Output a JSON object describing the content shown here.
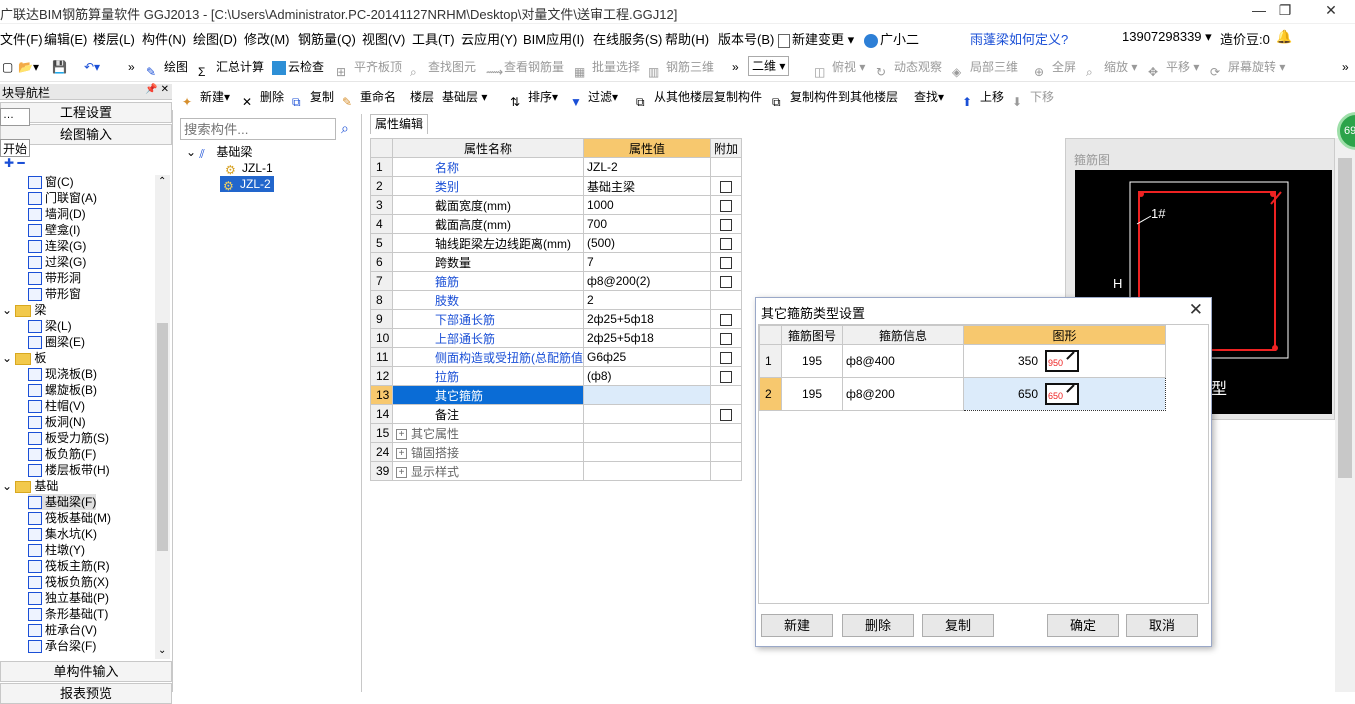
{
  "window": {
    "title": "广联达BIM钢筋算量软件 GGJ2013 - [C:\\Users\\Administrator.PC-20141127NRHM\\Desktop\\对量文件\\送审工程.GGJ12]",
    "min": "—",
    "restore": "❐",
    "close": "✕"
  },
  "menu": [
    "文件(F)",
    "编辑(E)",
    "楼层(L)",
    "构件(N)",
    "绘图(D)",
    "修改(M)",
    "钢筋量(Q)",
    "视图(V)",
    "工具(T)",
    "云应用(Y)",
    "BIM应用(I)",
    "在线服务(S)",
    "帮助(H)",
    "版本号(B)",
    "新建变更",
    "广小二",
    "雨蓬梁如何定义?",
    "13907298339",
    "造价豆:0"
  ],
  "toolbar1": [
    "绘图",
    "汇总计算",
    "云检查",
    "平齐板顶",
    "查找图元",
    "查看钢筋量",
    "批量选择",
    "钢筋三维",
    "二维",
    "俯视",
    "动态观察",
    "局部三维",
    "全屏",
    "缩放",
    "平移",
    "屏幕旋转"
  ],
  "toolbar2": [
    "新建",
    "删除",
    "复制",
    "重命名",
    "楼层",
    "基础层",
    "排序",
    "过滤",
    "从其他楼层复制构件",
    "复制构件到其他楼层",
    "查找",
    "上移",
    "下移"
  ],
  "left_panel": {
    "title": "块导航栏",
    "pin": "📌 ✕",
    "btn_project": "工程设置",
    "btn_draw": "绘图输入",
    "start_label": "开始",
    "small_box": "…",
    "items": [
      {
        "label": "窗(C)",
        "indent": 2
      },
      {
        "label": "门联窗(A)",
        "indent": 2
      },
      {
        "label": "墙洞(D)",
        "indent": 2
      },
      {
        "label": "壁龛(I)",
        "indent": 2
      },
      {
        "label": "连梁(G)",
        "indent": 2
      },
      {
        "label": "过梁(G)",
        "indent": 2
      },
      {
        "label": "带形洞",
        "indent": 2
      },
      {
        "label": "带形窗",
        "indent": 2
      },
      {
        "label": "梁",
        "indent": 1,
        "folder": true
      },
      {
        "label": "梁(L)",
        "indent": 2
      },
      {
        "label": "圈梁(E)",
        "indent": 2
      },
      {
        "label": "板",
        "indent": 1,
        "folder": true
      },
      {
        "label": "现浇板(B)",
        "indent": 2
      },
      {
        "label": "螺旋板(B)",
        "indent": 2
      },
      {
        "label": "柱帽(V)",
        "indent": 2
      },
      {
        "label": "板洞(N)",
        "indent": 2
      },
      {
        "label": "板受力筋(S)",
        "indent": 2
      },
      {
        "label": "板负筋(F)",
        "indent": 2
      },
      {
        "label": "楼层板带(H)",
        "indent": 2
      },
      {
        "label": "基础",
        "indent": 1,
        "folder": true
      },
      {
        "label": "基础梁(F)",
        "indent": 2,
        "selected": true
      },
      {
        "label": "筏板基础(M)",
        "indent": 2
      },
      {
        "label": "集水坑(K)",
        "indent": 2
      },
      {
        "label": "柱墩(Y)",
        "indent": 2
      },
      {
        "label": "筏板主筋(R)",
        "indent": 2
      },
      {
        "label": "筏板负筋(X)",
        "indent": 2
      },
      {
        "label": "独立基础(P)",
        "indent": 2
      },
      {
        "label": "条形基础(T)",
        "indent": 2
      },
      {
        "label": "桩承台(V)",
        "indent": 2
      },
      {
        "label": "承台梁(F)",
        "indent": 2
      }
    ],
    "btn_single": "单构件输入",
    "btn_report": "报表预览"
  },
  "component_tree": {
    "search_placeholder": "搜索构件...",
    "root": "基础梁",
    "children": [
      "JZL-1",
      "JZL-2"
    ]
  },
  "properties": {
    "tab": "属性编辑",
    "headers": [
      "属性名称",
      "属性值",
      "附加"
    ],
    "rows": [
      {
        "n": "1",
        "name": "名称",
        "value": "JZL-2",
        "blue": true,
        "cb": false
      },
      {
        "n": "2",
        "name": "类别",
        "value": "基础主梁",
        "blue": true,
        "cb": true
      },
      {
        "n": "3",
        "name": "截面宽度(mm)",
        "value": "1000",
        "cb": true
      },
      {
        "n": "4",
        "name": "截面高度(mm)",
        "value": "700",
        "cb": true
      },
      {
        "n": "5",
        "name": "轴线距梁左边线距离(mm)",
        "value": "(500)",
        "cb": true
      },
      {
        "n": "6",
        "name": "跨数量",
        "value": "7",
        "cb": true
      },
      {
        "n": "7",
        "name": "箍筋",
        "value": "ф8@200(2)",
        "blue": true,
        "cb": true
      },
      {
        "n": "8",
        "name": "肢数",
        "value": "2",
        "blue": true,
        "cb": false
      },
      {
        "n": "9",
        "name": "下部通长筋",
        "value": "2ф25+5ф18",
        "blue": true,
        "cb": true
      },
      {
        "n": "10",
        "name": "上部通长筋",
        "value": "2ф25+5ф18",
        "blue": true,
        "cb": true
      },
      {
        "n": "11",
        "name": "侧面构造或受扭筋(总配筋值)",
        "value": "G6ф25",
        "blue": true,
        "cb": true
      },
      {
        "n": "12",
        "name": "拉筋",
        "value": "(ф8)",
        "blue": true,
        "cb": true
      },
      {
        "n": "13",
        "name": "其它箍筋",
        "value": "",
        "selected": true,
        "cb": false
      },
      {
        "n": "14",
        "name": "备注",
        "value": "",
        "cb": true
      },
      {
        "n": "15",
        "name": "其它属性",
        "value": "",
        "group": true
      },
      {
        "n": "24",
        "name": "锚固搭接",
        "value": "",
        "group": true
      },
      {
        "n": "39",
        "name": "显示样式",
        "value": "",
        "group": true
      }
    ]
  },
  "preview": {
    "label": "箍筋图",
    "mark": "1#",
    "h_label": "H",
    "partial": "型"
  },
  "dialog": {
    "title": "其它箍筋类型设置",
    "close": "✕",
    "headers": [
      "箍筋图号",
      "箍筋信息",
      "图形"
    ],
    "rows": [
      {
        "n": "1",
        "code": "195",
        "info": "ф8@400",
        "dim": "350",
        "shape_label": "950"
      },
      {
        "n": "2",
        "code": "195",
        "info": "ф8@200",
        "dim": "650",
        "shape_label": "650"
      }
    ],
    "btn_new": "新建",
    "btn_delete": "删除",
    "btn_copy": "复制",
    "btn_ok": "确定",
    "btn_cancel": "取消"
  },
  "badge": "69"
}
